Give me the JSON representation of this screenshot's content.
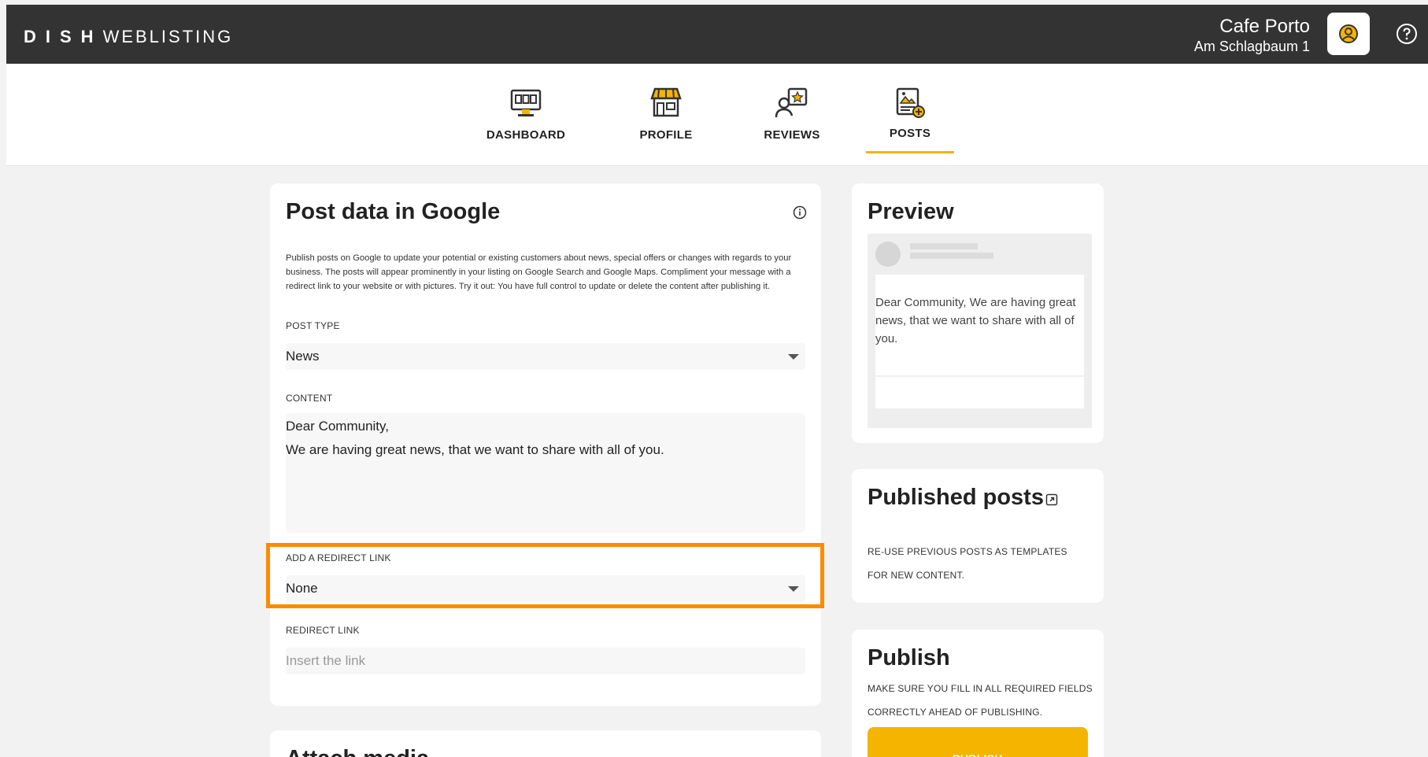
{
  "header": {
    "logo_bold": "DISH",
    "logo_light": "WEBLISTING",
    "business_name": "Cafe Porto",
    "business_address": "Am Schlagbaum 1"
  },
  "nav": {
    "items": [
      {
        "label": "DASHBOARD",
        "icon": "dashboard-monitor-icon"
      },
      {
        "label": "PROFILE",
        "icon": "storefront-icon"
      },
      {
        "label": "REVIEWS",
        "icon": "reviews-star-icon"
      },
      {
        "label": "POSTS",
        "icon": "posts-image-icon",
        "active": true
      }
    ]
  },
  "post_form": {
    "title": "Post data in Google",
    "description": "Publish posts on Google to update your potential or existing customers about news, special offers or changes with regards to your business. The posts will appear prominently in your listing on Google Search and Google Maps. Compliment your message with a redirect link to your website or with pictures. Try it out: You have full control to update or delete the content after publishing it.",
    "post_type_label": "POST TYPE",
    "post_type_value": "News",
    "content_label": "CONTENT",
    "content_value": "Dear Community,\nWe are having great news, that we want to share with all of you.",
    "redirect_select_label": "ADD A REDIRECT LINK",
    "redirect_select_value": "None",
    "redirect_link_label": "REDIRECT LINK",
    "redirect_link_placeholder": "Insert the link"
  },
  "attach": {
    "title": "Attach media"
  },
  "preview": {
    "title": "Preview",
    "text": "Dear Community, We are having great news, that we want to share with all of you."
  },
  "published": {
    "title": "Published posts",
    "description": "RE-USE PREVIOUS POSTS AS TEMPLATES FOR NEW CONTENT."
  },
  "publish": {
    "title": "Publish",
    "description": "MAKE SURE YOU FILL IN ALL REQUIRED FIELDS CORRECTLY AHEAD OF PUBLISHING.",
    "button_label": "PUBLISH"
  },
  "colors": {
    "topbar": "#333333",
    "accent": "#f5b400",
    "highlight": "#ff8a00",
    "background": "#f2f2f2"
  }
}
